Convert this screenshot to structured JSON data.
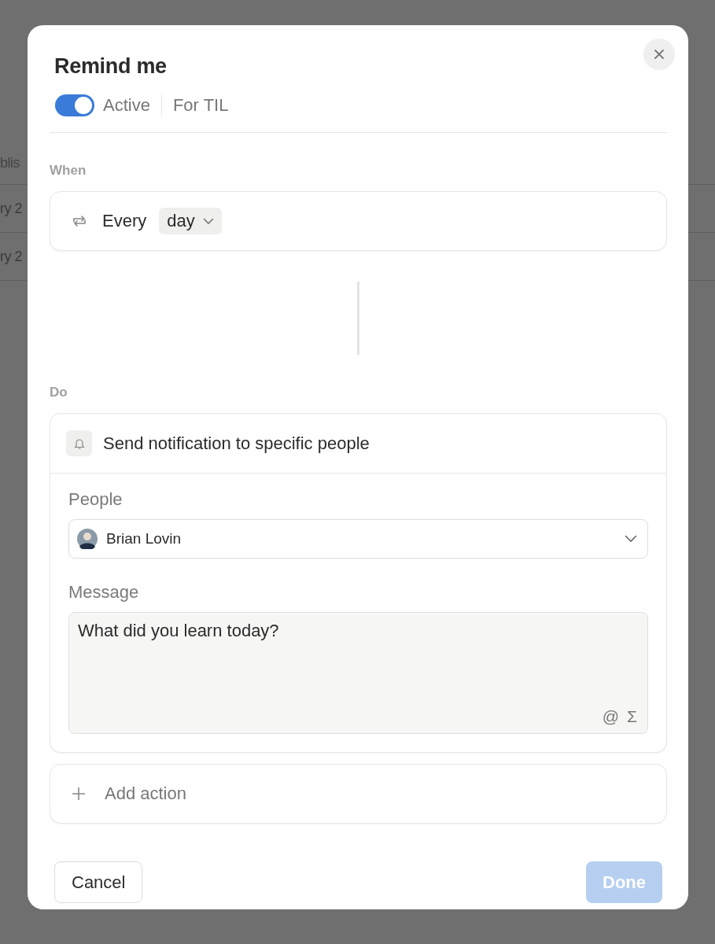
{
  "background_rows": [
    "blis",
    "ry 2",
    "ry 2"
  ],
  "dialog": {
    "title": "Remind me",
    "active_toggle": {
      "on": true,
      "label": "Active"
    },
    "database": "For TIL"
  },
  "trigger": {
    "heading": "When",
    "prefix": "Every",
    "unit": "day"
  },
  "action": {
    "heading": "Do",
    "title": "Send notification to specific people",
    "people_label": "People",
    "person": "Brian Lovin",
    "message_label": "Message",
    "message": "What did you learn today?",
    "tools": [
      "@",
      "Σ"
    ]
  },
  "add_action": "Add action",
  "buttons": {
    "cancel": "Cancel",
    "done": {
      "label": "Done",
      "disabled": true
    }
  }
}
